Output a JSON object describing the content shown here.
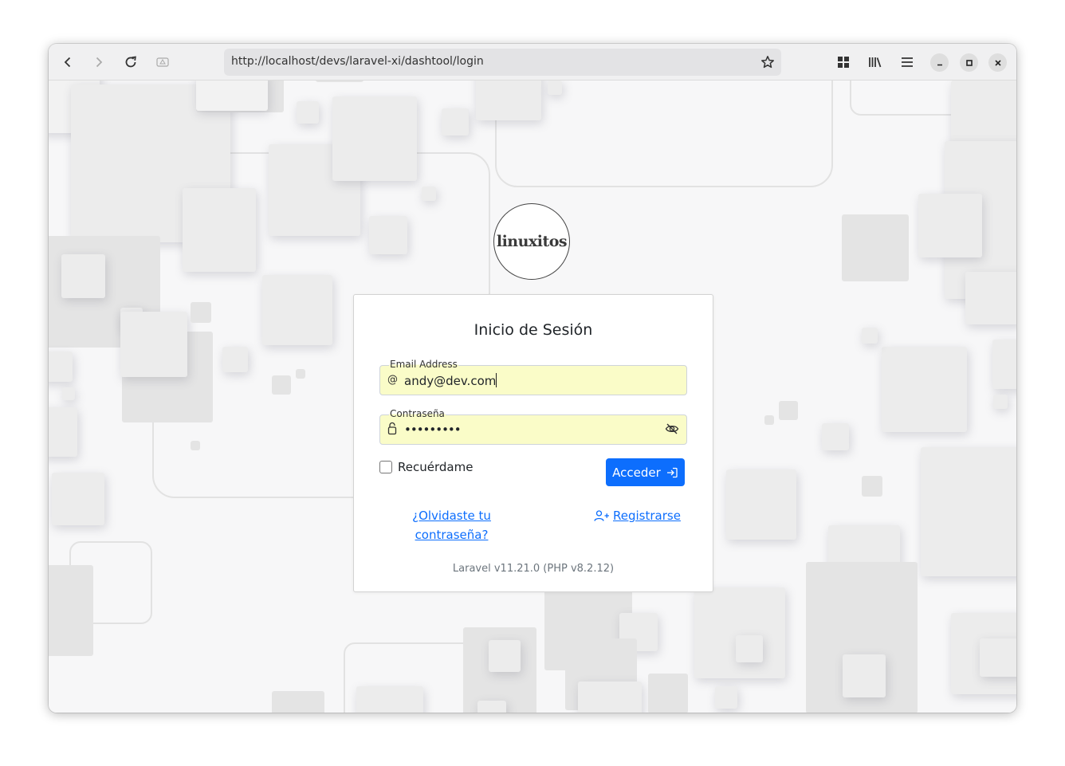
{
  "browser": {
    "url": "http://localhost/devs/laravel-xi/dashtool/login",
    "icons": [
      "back-arrow-icon",
      "forward-arrow-icon",
      "reload-icon",
      "page-info-icon",
      "bookmark-star-icon",
      "grid-icon",
      "library-icon",
      "hamburger-menu-icon",
      "minimize-icon",
      "maximize-icon",
      "close-icon"
    ]
  },
  "logo": {
    "text": "linuxitos"
  },
  "login": {
    "title": "Inicio de Sesión",
    "email_label": "Email Address",
    "email_value": "andy@dev.com",
    "password_label": "Contraseña",
    "password_value": "•••••••••",
    "remember_label": "Recuérdame",
    "submit_label": "Acceder",
    "forgot_line1": "¿Olvidaste tu",
    "forgot_line2": "contraseña?",
    "register_label": "Registrarse",
    "version": "Laravel v11.21.0 (PHP v8.2.12)"
  },
  "colors": {
    "accent": "#0d6efd",
    "autofill": "#fafcc8"
  }
}
